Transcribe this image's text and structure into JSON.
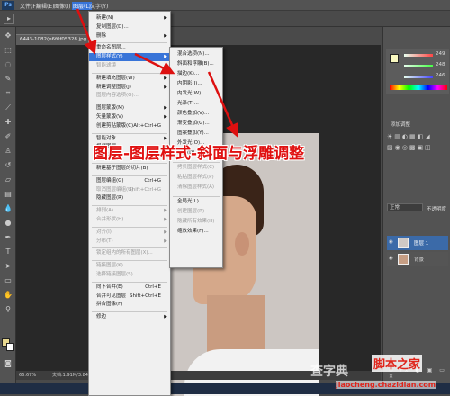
{
  "menubar": {
    "logo": "Ps",
    "items": [
      "文件(F)",
      "编辑(E)",
      "图像(I)",
      "图层(L)",
      "文字(Y)"
    ]
  },
  "document": {
    "tab": "6443-1082(e6f0f05328.jpg @ 66.7% (图层...",
    "zoom": "66.67%",
    "info": "文档:1.91M/3.84M"
  },
  "layer_menu": {
    "items": [
      {
        "label": "新建(N)",
        "arrow": true
      },
      {
        "label": "复制图层(D)..."
      },
      {
        "label": "删除",
        "arrow": true
      },
      {
        "sep": true
      },
      {
        "label": "重命名图层..."
      },
      {
        "label": "图层样式(Y)",
        "arrow": true,
        "highlight": true
      },
      {
        "label": "智能滤镜",
        "disabled": true
      },
      {
        "sep": true
      },
      {
        "label": "新建填充图层(W)",
        "arrow": true
      },
      {
        "label": "新建调整图层(J)",
        "arrow": true
      },
      {
        "label": "图层内容选项(O)...",
        "disabled": true
      },
      {
        "sep": true
      },
      {
        "label": "图层蒙版(M)",
        "arrow": true
      },
      {
        "label": "矢量蒙版(V)",
        "arrow": true
      },
      {
        "label": "创建剪贴蒙版(C)",
        "shortcut": "Alt+Ctrl+G"
      },
      {
        "sep": true
      },
      {
        "label": "智能对象",
        "arrow": true
      },
      {
        "label": "视频图层",
        "arrow": true
      },
      {
        "label": "栅格化(Z)",
        "arrow": true
      },
      {
        "sep": true
      },
      {
        "label": "新建基于图层的切片(B)"
      },
      {
        "sep": true
      },
      {
        "label": "图层编组(G)",
        "shortcut": "Ctrl+G"
      },
      {
        "label": "取消图层编组(U)",
        "shortcut": "Shift+Ctrl+G",
        "disabled": true
      },
      {
        "label": "隐藏图层(R)"
      },
      {
        "sep": true
      },
      {
        "label": "排列(A)",
        "arrow": true,
        "disabled": true
      },
      {
        "label": "合并形状(H)",
        "arrow": true,
        "disabled": true
      },
      {
        "sep": true
      },
      {
        "label": "对齐(I)",
        "arrow": true,
        "disabled": true
      },
      {
        "label": "分布(T)",
        "arrow": true,
        "disabled": true
      },
      {
        "sep": true
      },
      {
        "label": "锁定组内的所有图层(X)...",
        "disabled": true
      },
      {
        "sep": true
      },
      {
        "label": "链接图层(K)",
        "disabled": true
      },
      {
        "label": "选择链接图层(S)",
        "disabled": true
      },
      {
        "sep": true
      },
      {
        "label": "向下合并(E)",
        "shortcut": "Ctrl+E"
      },
      {
        "label": "合并可见图层",
        "shortcut": "Shift+Ctrl+E"
      },
      {
        "label": "拼合图像(F)"
      },
      {
        "sep": true
      },
      {
        "label": "修边",
        "arrow": true
      }
    ]
  },
  "style_submenu": {
    "items": [
      {
        "label": "混合选项(N)..."
      },
      {
        "label": "斜面和浮雕(B)..."
      },
      {
        "label": "描边(K)..."
      },
      {
        "label": "内阴影(I)..."
      },
      {
        "label": "内发光(W)..."
      },
      {
        "label": "光泽(T)..."
      },
      {
        "label": "颜色叠加(V)..."
      },
      {
        "label": "渐变叠加(G)..."
      },
      {
        "label": "图案叠加(Y)..."
      },
      {
        "label": "外发光(O)..."
      },
      {
        "label": "投影(D)..."
      },
      {
        "sep": true
      },
      {
        "label": "拷贝图层样式(C)",
        "disabled": true
      },
      {
        "label": "粘贴图层样式(P)",
        "disabled": true
      },
      {
        "label": "清除图层样式(A)",
        "disabled": true
      },
      {
        "sep": true
      },
      {
        "label": "全局光(L)..."
      },
      {
        "label": "创建图层(R)",
        "disabled": true
      },
      {
        "label": "隐藏所有效果(H)",
        "disabled": true
      },
      {
        "label": "缩放效果(F)..."
      }
    ]
  },
  "overlay_text": "图层-图层样式-斜面与浮雕调整",
  "right_panel": {
    "adjust_label": "添加调整",
    "blend_mode": "正常",
    "opacity_label": "不透明度",
    "layers": [
      {
        "name": "图层 1"
      },
      {
        "name": "背景"
      }
    ],
    "color_values": [
      "249",
      "248",
      "246"
    ]
  },
  "watermark": {
    "site1": "查字典",
    "site2": "脚本之家",
    "url": "jiaocheng.chazidian.com"
  },
  "colors": {
    "highlight": "#3874d8",
    "overlay": "#e01010",
    "arrow": "#dd1010"
  }
}
